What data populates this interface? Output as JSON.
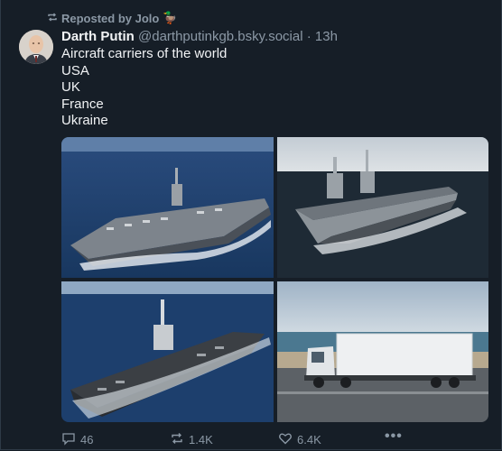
{
  "repost": {
    "label": "Reposted by Jolo",
    "emoji": "🦆"
  },
  "post": {
    "author_name": "Darth Putin",
    "handle": "@darthputinkgb.bsky.social",
    "separator": "·",
    "time": "13h",
    "lines": [
      "Aircraft carriers of the world",
      "USA",
      "UK",
      "France",
      "Ukraine"
    ]
  },
  "actions": {
    "replies": "46",
    "reposts": "1.4K",
    "likes": "6.4K",
    "more": "•••"
  },
  "colors": {
    "background": "#161e27",
    "text": "#f1f3f5",
    "muted": "#8b98a5"
  },
  "icons": [
    "repost-icon",
    "reply-icon",
    "like-icon",
    "more-icon"
  ]
}
